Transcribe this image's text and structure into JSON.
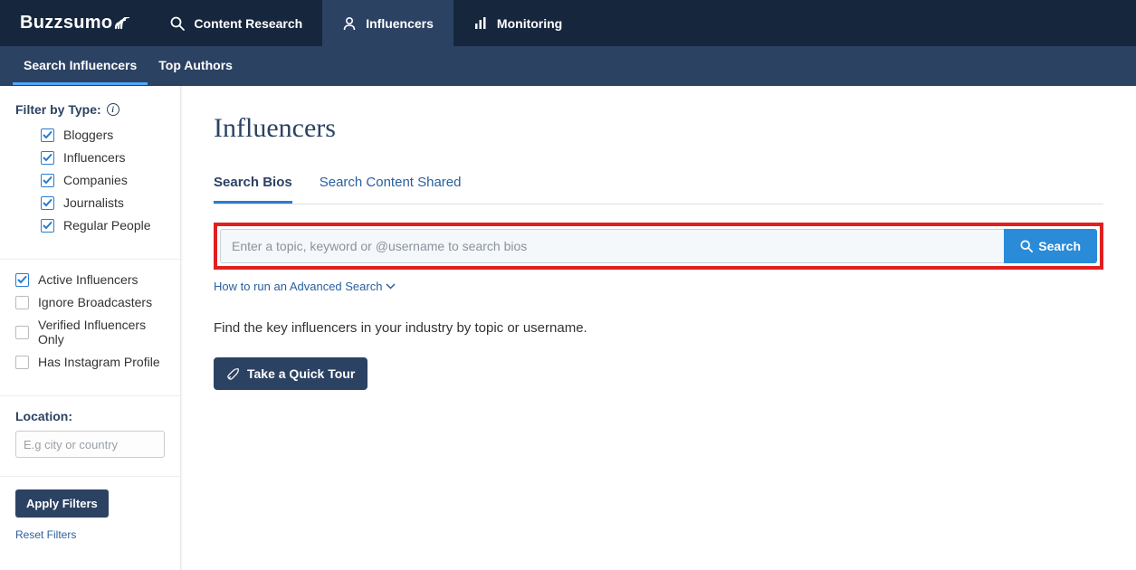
{
  "logo_text": "Buzzsumo",
  "nav": {
    "content_research": "Content Research",
    "influencers": "Influencers",
    "monitoring": "Monitoring"
  },
  "subnav": {
    "search_influencers": "Search Influencers",
    "top_authors": "Top Authors"
  },
  "sidebar": {
    "filter_by_type": "Filter by Type:",
    "types": {
      "bloggers": "Bloggers",
      "influencers": "Influencers",
      "companies": "Companies",
      "journalists": "Journalists",
      "regular_people": "Regular People"
    },
    "options": {
      "active_influencers": "Active Influencers",
      "ignore_broadcasters": "Ignore Broadcasters",
      "verified_only": "Verified Influencers Only",
      "has_instagram": "Has Instagram Profile"
    },
    "location_label": "Location:",
    "location_placeholder": "E.g city or country",
    "apply_filters": "Apply Filters",
    "reset_filters": "Reset Filters"
  },
  "main": {
    "title": "Influencers",
    "tabs": {
      "search_bios": "Search Bios",
      "search_content_shared": "Search Content Shared"
    },
    "search_placeholder": "Enter a topic, keyword or @username to search bios",
    "search_button": "Search",
    "advanced_search": "How to run an Advanced Search",
    "description": "Find the key influencers in your industry by topic or username.",
    "tour_button": "Take a Quick Tour"
  }
}
